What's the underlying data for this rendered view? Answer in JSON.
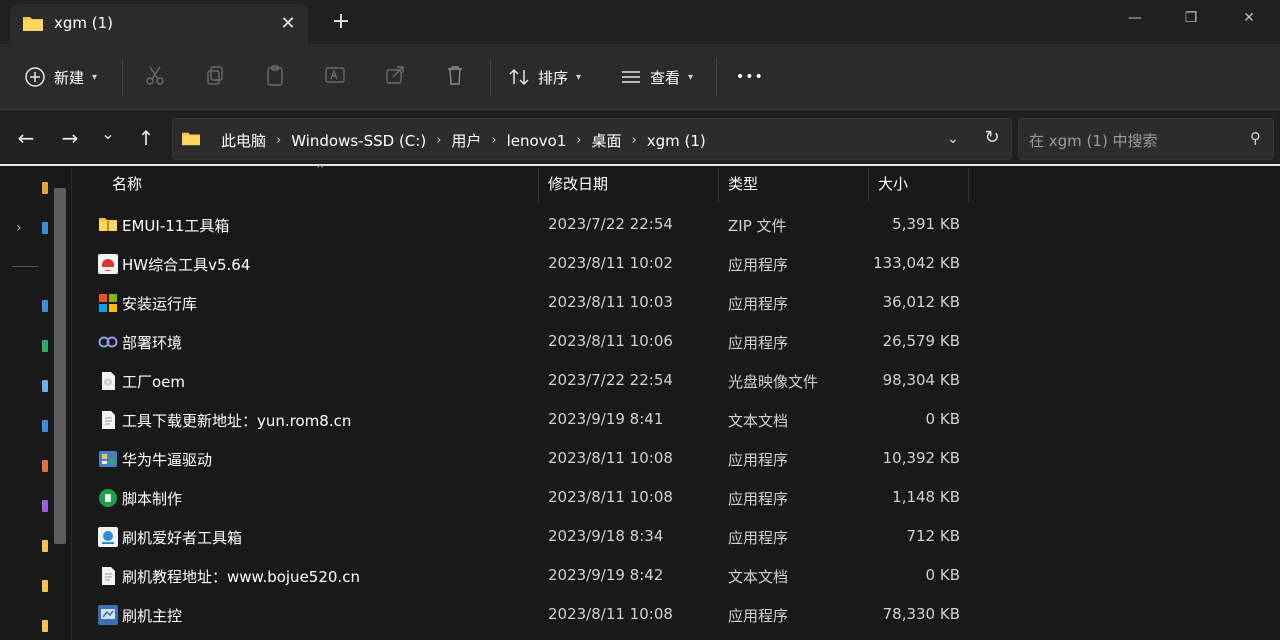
{
  "window": {
    "tab_title": "xgm (1)",
    "tab_close": "✕",
    "new_tab": "+",
    "minimize": "—",
    "maximize": "❐",
    "close": "✕"
  },
  "toolbar": {
    "new_label": "新建",
    "sort_label": "排序",
    "view_label": "查看",
    "more_label": "•••"
  },
  "nav": {
    "back": "←",
    "forward": "→",
    "recent": "⌄",
    "up": "↑"
  },
  "address": {
    "crumbs": [
      "此电脑",
      "Windows-SSD (C:)",
      "用户",
      "lenovo1",
      "桌面",
      "xgm (1)"
    ],
    "separator": "›",
    "dropdown": "⌄",
    "refresh": "↻"
  },
  "search": {
    "placeholder": "在 xgm (1) 中搜索",
    "icon": "⚲"
  },
  "columns": {
    "name": "名称",
    "date": "修改日期",
    "type": "类型",
    "size": "大小"
  },
  "files": [
    {
      "name": "EMUI-11工具箱",
      "date": "2023/7/22 22:54",
      "type": "ZIP 文件",
      "size": "5,391 KB",
      "icon": "zip-folder-icon"
    },
    {
      "name": "HW综合工具v5.64",
      "date": "2023/8/11 10:02",
      "type": "应用程序",
      "size": "133,042 KB",
      "icon": "huawei-app-icon"
    },
    {
      "name": "安装运行库",
      "date": "2023/8/11 10:03",
      "type": "应用程序",
      "size": "36,012 KB",
      "icon": "windows-app-icon"
    },
    {
      "name": "部署环境",
      "date": "2023/8/11 10:06",
      "type": "应用程序",
      "size": "26,579 KB",
      "icon": "infinity-app-icon"
    },
    {
      "name": "工厂oem",
      "date": "2023/7/22 22:54",
      "type": "光盘映像文件",
      "size": "98,304 KB",
      "icon": "disc-image-icon"
    },
    {
      "name": "工具下载更新地址：yun.rom8.cn",
      "date": "2023/9/19 8:41",
      "type": "文本文档",
      "size": "0 KB",
      "icon": "text-file-icon"
    },
    {
      "name": "华为牛逼驱动",
      "date": "2023/8/11 10:08",
      "type": "应用程序",
      "size": "10,392 KB",
      "icon": "driver-app-icon"
    },
    {
      "name": "脚本制作",
      "date": "2023/8/11 10:08",
      "type": "应用程序",
      "size": "1,148 KB",
      "icon": "script-app-icon"
    },
    {
      "name": "刷机爱好者工具箱",
      "date": "2023/9/18 8:34",
      "type": "应用程序",
      "size": "712 KB",
      "icon": "flash-tool-icon"
    },
    {
      "name": "刷机教程地址：www.bojue520.cn",
      "date": "2023/9/19 8:42",
      "type": "文本文档",
      "size": "0 KB",
      "icon": "text-file-icon"
    },
    {
      "name": "刷机主控",
      "date": "2023/8/11 10:08",
      "type": "应用程序",
      "size": "78,330 KB",
      "icon": "flash-master-icon"
    }
  ]
}
